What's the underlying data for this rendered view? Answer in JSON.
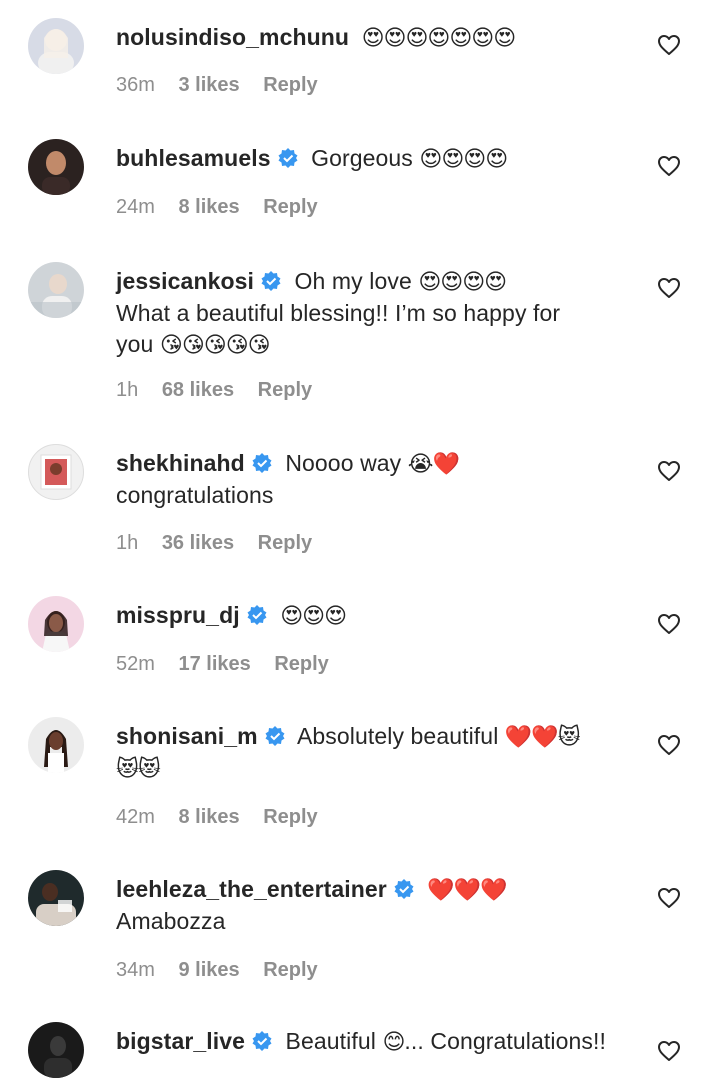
{
  "comments": [
    {
      "username": "nolusindiso_mchunu",
      "verified": false,
      "text": "",
      "emojis": "😍😍😍😍😍😍😍",
      "time": "36m",
      "likes": "3 likes",
      "reply": "Reply",
      "avatar_color": "#d7dbe6",
      "avatar_accent": "#f2e9e2"
    },
    {
      "username": "buhlesamuels",
      "verified": true,
      "text": "Gorgeous",
      "emojis": "😍😍😍😍",
      "time": "24m",
      "likes": "8 likes",
      "reply": "Reply",
      "avatar_color": "#2b2220",
      "avatar_accent": "#c18a6a"
    },
    {
      "username": "jessicankosi",
      "verified": true,
      "text": "Oh my love",
      "emojis": "😍😍😍😍",
      "line2": "What a beautiful blessing!! I’m so happy for",
      "line3": "you",
      "emojis2": "😘😘😘😘😘",
      "time": "1h",
      "likes": "68 likes",
      "reply": "Reply",
      "avatar_color": "#cfd4d8",
      "avatar_accent": "#f0f0f0"
    },
    {
      "username": "shekhinahd",
      "verified": true,
      "text": "Noooo way",
      "emojis": "😭❤️",
      "line2": "congratulations",
      "time": "1h",
      "likes": "36 likes",
      "reply": "Reply",
      "avatar_color": "#f1f1f1",
      "avatar_accent": "#c84a4a"
    },
    {
      "username": "misspru_dj",
      "verified": true,
      "text": "",
      "emojis": "😍😍😍",
      "time": "52m",
      "likes": "17 likes",
      "reply": "Reply",
      "avatar_color": "#f3d7e4",
      "avatar_accent": "#2a1a1a"
    },
    {
      "username": "shonisani_m",
      "verified": true,
      "text": "Absolutely beautiful",
      "emojis": "❤️❤️😻",
      "line2emojis": "😻😻",
      "time": "42m",
      "likes": "8 likes",
      "reply": "Reply",
      "avatar_color": "#ececec",
      "avatar_accent": "#3a2a22"
    },
    {
      "username": "leehleza_the_entertainer",
      "verified": true,
      "text": "",
      "emojis": "❤️❤️❤️",
      "line2": "Amabozza",
      "time": "34m",
      "likes": "9 likes",
      "reply": "Reply",
      "avatar_color": "#1f2a2c",
      "avatar_accent": "#d8cfc6"
    },
    {
      "username": "bigstar_live",
      "verified": true,
      "text": "Beautiful",
      "emojis": "😊",
      "tail": "... Congratulations!!",
      "avatar_color": "#1a1a1a",
      "avatar_accent": "#4a4a4a"
    }
  ],
  "colors": {
    "verified": "#3897f0",
    "meta": "#8e8e8e",
    "text": "#262626"
  }
}
